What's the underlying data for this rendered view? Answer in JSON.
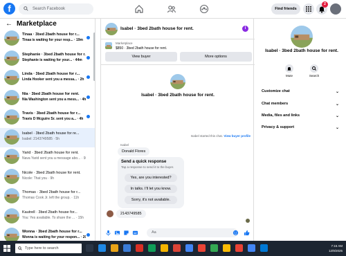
{
  "topbar": {
    "logo": "f",
    "search_placeholder": "Search Facebook",
    "find_friends": "Find friends",
    "notif_count": "2",
    "icons": [
      "home-icon",
      "friends-icon",
      "groups-icon",
      "grid-menu-icon",
      "messenger-icon",
      "bell-icon"
    ]
  },
  "sidebar": {
    "title": "Marketplace",
    "conversations": [
      {
        "name": "Tinaa · 3bed 2bath house for r...",
        "preview": "Tinaa is waiting for your resp... · 19m",
        "unread": true
      },
      {
        "name": "Stephanie · 3bed 2bath house for r...",
        "preview": "Stephanie is waiting for your... · 44m",
        "unread": true
      },
      {
        "name": "Linda · 3bed 2bath house for r...",
        "preview": "Linda Hooker sent you a messa... · 2h",
        "unread": true
      },
      {
        "name": "Nia · 3bed 2bath house for rent.",
        "preview": "Nia Washington sent you a mess... · 4h",
        "unread": true
      },
      {
        "name": "Travis · 3bed 2bath house for r...",
        "preview": "Travis D Mcguire Sr. sent you a... · 4h",
        "unread": true
      },
      {
        "name": "Isabel · 3bed 2bath house for re...",
        "preview": "Isabel: 2143749585 · 5h",
        "unread": false,
        "active": true
      },
      {
        "name": "Yarid · 3bed 2bath house for rent.",
        "preview": "Nava Yarid sent you a message abo... · 9h",
        "unread": false
      },
      {
        "name": "Nicole · 3bed 2bath house for rent.",
        "preview": "Nicole: That you · 9h",
        "unread": false
      },
      {
        "name": "Thomas · 3bed 2bath house for r...",
        "preview": "Thomas Cook Jr. left the group. · 11h",
        "unread": false
      },
      {
        "name": "Kautrell · 3bed 2bath house for...",
        "preview": "You: Yes available. To share the ... · 15h",
        "unread": false
      },
      {
        "name": "Wonna · 3bed 2bath house for r...",
        "preview": "Wonna is waiting for your respon... · 20h",
        "unread": true
      }
    ]
  },
  "chat": {
    "title": "Isabel · 3bed 2bath house for rent.",
    "listing_label": "Marketplace",
    "listing_price": "$850 · 3bed 2bath house for rent.",
    "view_buyer": "View buyer",
    "more_options": "More options",
    "card_title": "Isabel · 3bed 2bath house for rent.",
    "started_text": "Isabel started this chat.",
    "started_link": "View buyer profile",
    "sender_label": "Isabel",
    "first_message": "Donald Flores",
    "quick_title": "Send a quick response",
    "quick_sub": "Tap a response to send it to the buyer.",
    "quick_replies": [
      "Yes, are you interested?",
      "In talks. I'll let you know.",
      "Sorry, it's not available."
    ],
    "last_message": "2143749585",
    "composer_placeholder": "Aa"
  },
  "details": {
    "title": "Isabel · 3bed 2bath house for rent.",
    "mute": "Mute",
    "search": "Search",
    "rows": [
      "Customize chat",
      "Chat members",
      "Media, files and links",
      "Privacy & support"
    ]
  },
  "taskbar": {
    "search_placeholder": "Type here to search",
    "time": "7:16 AM",
    "date": "12/9/2025"
  },
  "colors": {
    "brand": "#1877f2",
    "badge": "#e41e3f",
    "active_conv": "#e7f0fd"
  }
}
